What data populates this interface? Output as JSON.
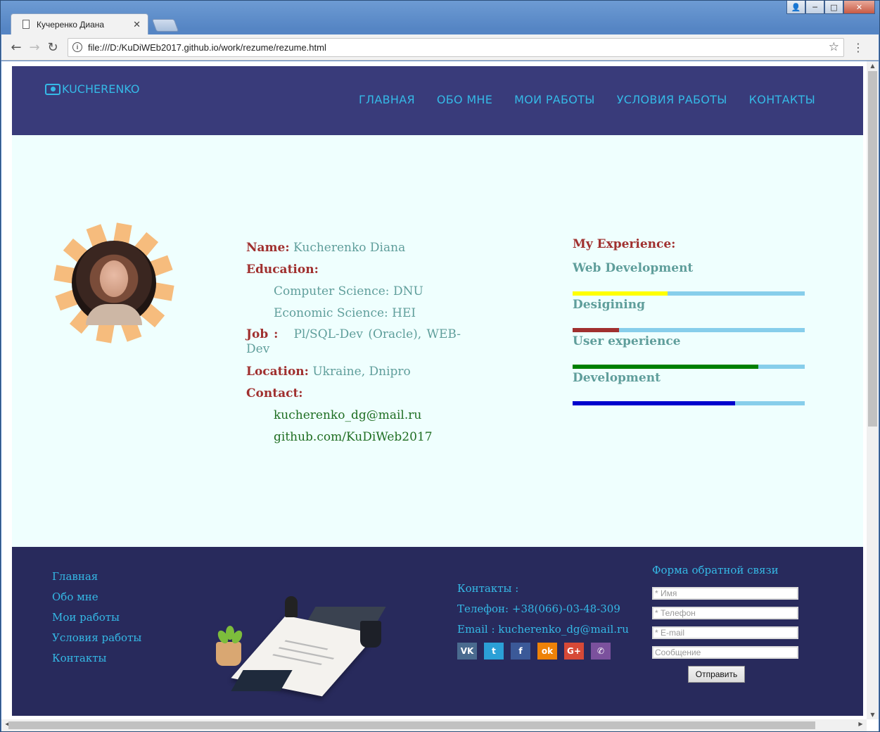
{
  "browser": {
    "tab_title": "Кучеренко Диана",
    "tab_close": "✕",
    "url": "file:///D:/KuDiWEb2017.github.io/work/rezume/rezume.html"
  },
  "header": {
    "logo_text": "KUCHERENKO",
    "nav": [
      "ГЛАВНАЯ",
      "ОБО МНЕ",
      "МОИ РАБОТЫ",
      "УСЛОВИЯ РАБОТЫ",
      "КОНТАКТЫ"
    ]
  },
  "profile": {
    "name_label": "Name:",
    "name_value": "Kucherenko Diana",
    "education_label": "Education:",
    "education": [
      "Computer Science: DNU",
      "Economic Science: HEI"
    ],
    "job_label": "Job :",
    "job_value": "Pl/SQL-Dev (Oracle), WEB-Dev",
    "location_label": "Location:",
    "location_value": "Ukraine, Dnipro",
    "contact_label": "Contact:",
    "contacts": [
      "kucherenko_dg@mail.ru",
      "github.com/KuDiWeb2017"
    ]
  },
  "experience": {
    "title": "My Experience:",
    "skills": [
      {
        "name": "Web Development",
        "level": 0.41,
        "color": "#ffff00"
      },
      {
        "name": "Desigining",
        "level": 0.2,
        "color": "#a0302f"
      },
      {
        "name": "User experience",
        "level": 0.8,
        "color": "#008000"
      },
      {
        "name": "Development",
        "level": 0.7,
        "color": "#0000cd"
      }
    ]
  },
  "footer": {
    "links": [
      "Главная",
      "Обо мне",
      "Мои работы",
      "Условия работы",
      "Контакты"
    ],
    "contacts_title": "Контакты :",
    "phone": "Телефон: +38(066)-03-48-309",
    "email": "Email : kucherenko_dg@mail.ru",
    "socials": [
      {
        "icon": "vk-icon",
        "text": "VK",
        "color": "#4a6b8f"
      },
      {
        "icon": "twitter-icon",
        "text": "t",
        "color": "#2ba0d6"
      },
      {
        "icon": "facebook-icon",
        "text": "f",
        "color": "#3b5998"
      },
      {
        "icon": "odnoklassniki-icon",
        "text": "ok",
        "color": "#ee8208"
      },
      {
        "icon": "google-plus-icon",
        "text": "G+",
        "color": "#d64937"
      },
      {
        "icon": "viber-icon",
        "text": "✆",
        "color": "#7b519d"
      }
    ],
    "form": {
      "title": "Форма обратной связи",
      "name_placeholder": "* Имя",
      "phone_placeholder": "* Телефон",
      "email_placeholder": "* E-mail",
      "message_placeholder": "Сообщение",
      "submit_label": "Отправить"
    }
  }
}
